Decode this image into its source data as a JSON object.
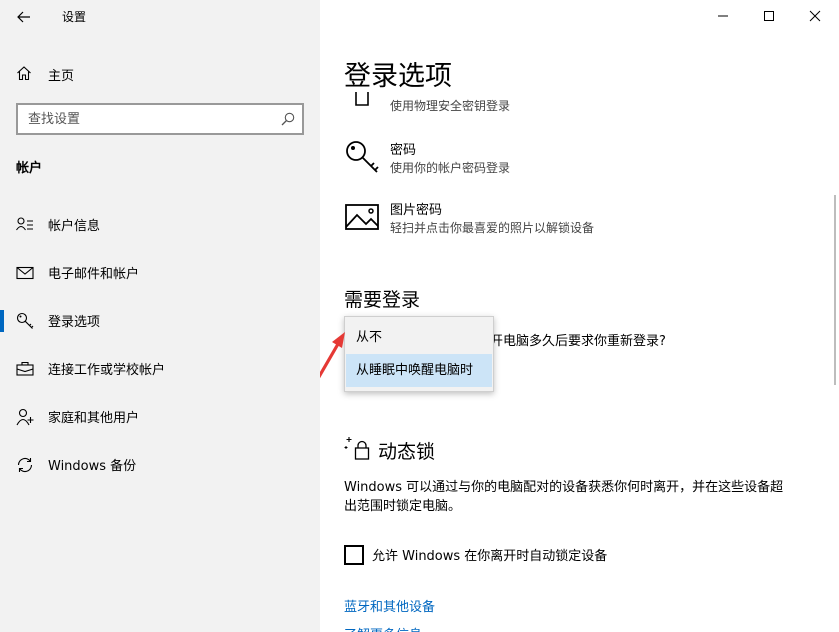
{
  "window": {
    "title": "设置"
  },
  "sidebar": {
    "home_label": "主页",
    "search_placeholder": "查找设置",
    "section_title": "帐户",
    "items": [
      {
        "label": "帐户信息",
        "icon": "account-info-icon"
      },
      {
        "label": "电子邮件和帐户",
        "icon": "mail-icon"
      },
      {
        "label": "登录选项",
        "icon": "key-icon"
      },
      {
        "label": "连接工作或学校帐户",
        "icon": "briefcase-icon"
      },
      {
        "label": "家庭和其他用户",
        "icon": "person-add-icon"
      },
      {
        "label": "Windows 备份",
        "icon": "sync-icon"
      }
    ],
    "active_index": 2
  },
  "main": {
    "page_title": "登录选项",
    "options": [
      {
        "title": "",
        "desc": "使用物理安全密钥登录",
        "icon": "usb-key-icon"
      },
      {
        "title": "密码",
        "desc": "使用你的帐户密码登录",
        "icon": "key-icon"
      },
      {
        "title": "图片密码",
        "desc": "轻扫并点击你最喜爱的照片以解锁设备",
        "icon": "picture-icon"
      }
    ],
    "require_signin": {
      "heading": "需要登录",
      "question": "开电脑多久后要求你重新登录?",
      "dropdown_options": [
        "从不",
        "从睡眠中唤醒电脑时"
      ],
      "selected_index": 1
    },
    "dynamic_lock": {
      "heading": "动态锁",
      "description": "Windows 可以通过与你的电脑配对的设备获悉你何时离开，并在这些设备超出范围时锁定电脑。",
      "checkbox_label": "允许 Windows 在你离开时自动锁定设备",
      "checked": false
    },
    "links": [
      "蓝牙和其他设备",
      "了解更多信息"
    ]
  },
  "colors": {
    "accent": "#0067c0",
    "sidebar_bg": "#f2f2f2",
    "selected_bg": "#cce4f7",
    "arrow": "#e53935"
  }
}
